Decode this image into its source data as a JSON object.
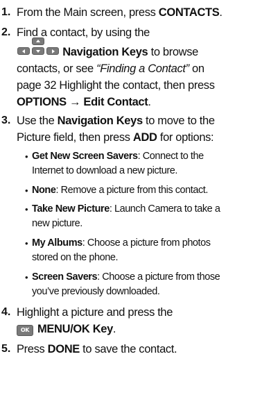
{
  "steps": [
    {
      "number": "1.",
      "lines": [
        {
          "a": "From the Main screen, press ",
          "b": "CONTACTS",
          "c": "."
        }
      ]
    },
    {
      "number": "2.",
      "line1": "Find a contact, by using the",
      "nav_icon": "navigation-keys-icon",
      "nav_label": "Navigation Keys",
      "nav_after": " to browse",
      "line3_a": "contacts, or see ",
      "line3_ref": "“Finding a Contact”",
      "line3_b": " on",
      "line4": "page 32 Highlight the contact, then press",
      "line5_bold": "OPTIONS → Edit Contact",
      "line5_end": "."
    },
    {
      "number": "3.",
      "line1_a": "Use the ",
      "line1_b": "Navigation Keys",
      "line1_c": " to move to the",
      "line2_a": "Picture field, then press ",
      "line2_b": "ADD",
      "line2_c": " for options:"
    },
    {
      "number": "4.",
      "line1": "Highlight a picture and press the",
      "ok_icon_text": "OK",
      "ok_label": "MENU/OK Key",
      "ok_end": "."
    },
    {
      "number": "5.",
      "a": "Press ",
      "b": "DONE",
      "c": " to save the contact."
    }
  ],
  "options": [
    {
      "title": "Get New Screen Savers",
      "desc1": ": Connect to the",
      "desc2": "Internet to download a new picture."
    },
    {
      "title": "None",
      "desc1": ": Remove a picture from this contact.",
      "desc2": ""
    },
    {
      "title": "Take New Picture",
      "desc1": ": Launch Camera to take a",
      "desc2": "new picture."
    },
    {
      "title": "My Albums",
      "desc1": ": Choose a picture from photos",
      "desc2": "stored on the phone."
    },
    {
      "title": "Screen Savers",
      "desc1": ": Choose a picture from those",
      "desc2": "you’ve previously downloaded."
    }
  ],
  "bullet": "•"
}
